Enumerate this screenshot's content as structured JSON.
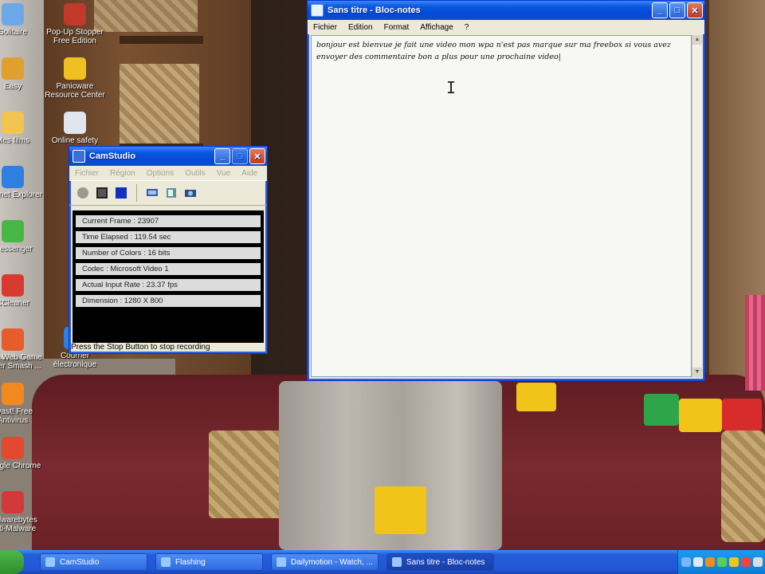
{
  "desktop": {
    "icons_left": [
      {
        "label": "Solitaire",
        "color": "#6fa8e8",
        "icon": "solitaire-icon"
      },
      {
        "label": "Easy",
        "color": "#e0a030",
        "icon": "easy-icon"
      },
      {
        "label": "Mes films",
        "color": "#f1c550",
        "icon": "folder-icon"
      },
      {
        "label": "Internet Explorer",
        "color": "#2f7fe0",
        "icon": "internet-explorer-icon"
      },
      {
        "label": "Messenger",
        "color": "#47b847",
        "icon": "messenger-icon"
      },
      {
        "label": "CCleaner",
        "color": "#d93a2f",
        "icon": "ccleaner-icon"
      },
      {
        "label": "Free Web Game Super Smash ...",
        "color": "#e65c2a",
        "icon": "chrome-icon"
      },
      {
        "label": "avast! Free Antivirus",
        "color": "#f08a1e",
        "icon": "avast-icon"
      },
      {
        "label": "Google Chrome",
        "color": "#e2492f",
        "icon": "chrome-icon"
      },
      {
        "label": "Malwarebytes Anti-Malware",
        "color": "#d23a3a",
        "icon": "malwarebytes-icon"
      }
    ],
    "icons_mid": [
      {
        "label": "Pop-Up Stopper Free Edition",
        "color": "#c0392b",
        "icon": "popup-stopper-icon"
      },
      {
        "label": "Panicware Resource Center",
        "color": "#f0c020",
        "icon": "panicware-icon"
      },
      {
        "label": "Online safety",
        "color": "#dfe6ee",
        "icon": "document-icon"
      },
      {
        "label": "Courrier électronique",
        "color": "#2f7fe0",
        "icon": "mail-icon"
      }
    ]
  },
  "camstudio": {
    "title": "CamStudio",
    "menu": [
      "Fichier",
      "Région",
      "Options",
      "Outils",
      "Vue",
      "Aide"
    ],
    "stats": [
      "Current Frame : 23907",
      "Time Elapsed : 119.54 sec",
      "Number of Colors : 16 bits",
      "Codec : Microsoft Video 1",
      "Actual Input Rate : 23.37 fps",
      "Dimension : 1280 X 800"
    ],
    "status": "Press the Stop Button to stop recording"
  },
  "notepad": {
    "title": "Sans titre - Bloc-notes",
    "menu": [
      "Fichier",
      "Edition",
      "Format",
      "Affichage",
      "?"
    ],
    "text": "bonjour est bienvue je fait une video mon wpa n'est pas marque sur ma freebox si vous avez envoyer des commentaire bon a plus pour une prochaine video"
  },
  "taskbar": {
    "tasks": [
      {
        "label": "CamStudio",
        "active": false
      },
      {
        "label": "Flashing",
        "active": false
      },
      {
        "label": "Dailymotion - Watch, ...",
        "active": false
      },
      {
        "label": "Sans titre - Bloc-notes",
        "active": true
      }
    ]
  },
  "colors": {
    "xp_blue": "#0548d6",
    "close_red": "#c2391c",
    "taskbar": "#245ddb",
    "start_green": "#2f8e2b"
  }
}
